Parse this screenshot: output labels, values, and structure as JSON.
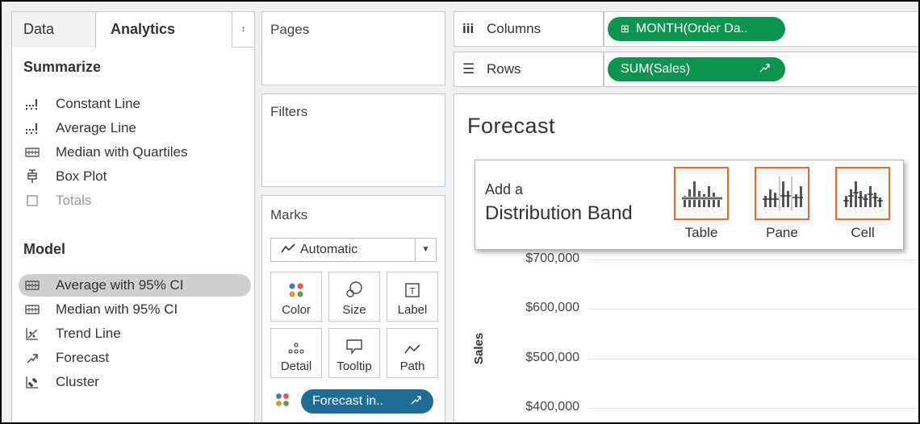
{
  "left_pane": {
    "tabs": [
      {
        "label": "Data"
      },
      {
        "label": "Analytics"
      }
    ],
    "tab_toggle": "↕",
    "summarize": {
      "title": "Summarize",
      "items": [
        {
          "label": "Constant Line",
          "icon": "constant-line-icon"
        },
        {
          "label": "Average Line",
          "icon": "average-line-icon"
        },
        {
          "label": "Median with Quartiles",
          "icon": "median-quartiles-icon"
        },
        {
          "label": "Box Plot",
          "icon": "box-plot-icon"
        },
        {
          "label": "Totals",
          "icon": "totals-icon",
          "disabled": true
        }
      ]
    },
    "model": {
      "title": "Model",
      "items": [
        {
          "label": "Average with 95% CI",
          "icon": "average-ci-icon",
          "selected": true
        },
        {
          "label": "Median with 95% CI",
          "icon": "median-ci-icon"
        },
        {
          "label": "Trend Line",
          "icon": "trend-line-icon"
        },
        {
          "label": "Forecast",
          "icon": "forecast-icon"
        },
        {
          "label": "Cluster",
          "icon": "cluster-icon"
        }
      ]
    }
  },
  "cards": {
    "pages_title": "Pages",
    "filters_title": "Filters",
    "marks": {
      "title": "Marks",
      "mark_type": "Automatic",
      "buttons": [
        {
          "label": "Color",
          "icon": "color-icon"
        },
        {
          "label": "Size",
          "icon": "size-icon"
        },
        {
          "label": "Label",
          "icon": "label-icon"
        },
        {
          "label": "Detail",
          "icon": "detail-icon"
        },
        {
          "label": "Tooltip",
          "icon": "tooltip-icon"
        },
        {
          "label": "Path",
          "icon": "path-icon"
        }
      ],
      "pill": {
        "label": "Forecast in..",
        "icon": "forecast-pill-icon"
      }
    }
  },
  "shelves": {
    "columns": {
      "label": "Columns",
      "pill": "MONTH(Order Da.."
    },
    "rows": {
      "label": "Rows",
      "pill": "SUM(Sales)"
    }
  },
  "view": {
    "title": "Forecast",
    "y_axis_label": "Sales",
    "ticks": [
      "$700,000",
      "$600,000",
      "$500,000",
      "$400,000"
    ]
  },
  "popup": {
    "add_label": "Add a",
    "title": "Distribution Band",
    "options": [
      {
        "label": "Table",
        "icon": "table-band-icon"
      },
      {
        "label": "Pane",
        "icon": "pane-band-icon"
      },
      {
        "label": "Cell",
        "icon": "cell-band-icon"
      }
    ]
  },
  "colors": {
    "pill_blue": "#1f6c94",
    "pill_green": "#0f9350",
    "band_highlight": "#e06a34",
    "selected_item": "#cfcfcf"
  }
}
